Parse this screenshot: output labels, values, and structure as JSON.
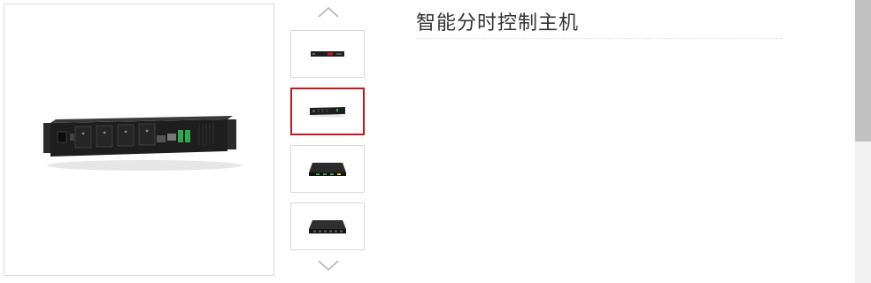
{
  "product": {
    "title": "智能分时控制主机"
  },
  "gallery": {
    "main_image": "pdu-side-view-image",
    "thumbnails": [
      {
        "icon": "rack-unit-front-thumbnail",
        "selected": false
      },
      {
        "icon": "rack-unit-side-thumbnail",
        "selected": true
      },
      {
        "icon": "rack-unit-top-green-thumbnail",
        "selected": false
      },
      {
        "icon": "rack-unit-top-dark-thumbnail",
        "selected": false
      }
    ],
    "selected_color": "#c8161d"
  }
}
